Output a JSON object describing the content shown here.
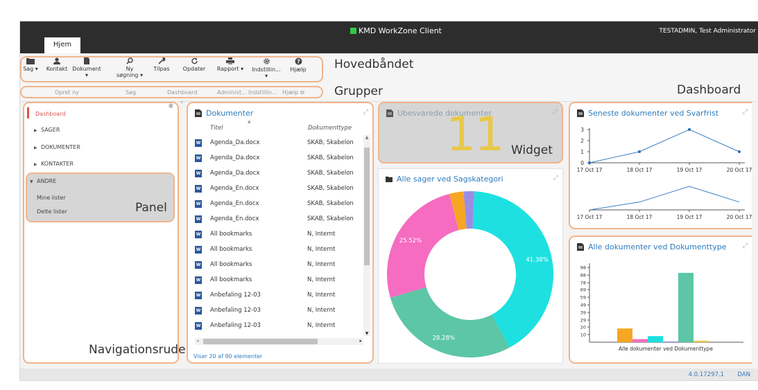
{
  "window": {
    "title": "KMD WorkZone Client",
    "user": "TESTADMIN, Test Administrator"
  },
  "tabs": [
    {
      "label": "Hjem"
    }
  ],
  "ribbon": {
    "buttons": [
      {
        "label": "Sag",
        "dropdown": true
      },
      {
        "label": "Kontakt"
      },
      {
        "label": "Dokument"
      },
      {
        "label": "Ny søgning"
      },
      {
        "label": "Tilpas"
      },
      {
        "label": "Opdater"
      },
      {
        "label": "Rapport",
        "dropdown": true
      },
      {
        "label": "Indstillin..."
      },
      {
        "label": "Hjælp"
      }
    ],
    "groups": [
      "Opret ny",
      "Søg",
      "Dashboard",
      "Administ...",
      "Indstillin...",
      "Hjælp"
    ]
  },
  "callouts": {
    "ribbon": "Hovedbåndet",
    "groups": "Grupper",
    "dashboard": "Dashboard",
    "widget": "Widget",
    "panel": "Panel",
    "nav": "Navigationsrude"
  },
  "nav": {
    "dashboard": "Dashboard",
    "items": [
      "SAGER",
      "DOKUMENTER",
      "KONTAKTER"
    ],
    "andre": "ANDRE",
    "sub": [
      "Mine lister",
      "Delte lister"
    ]
  },
  "documents": {
    "title": "Dokumenter",
    "columns": [
      "Titel",
      "Dokumenttype"
    ],
    "rows": [
      {
        "title": "Agenda_Da.docx",
        "type": "SKAB, Skabelon"
      },
      {
        "title": "Agenda_Da.docx",
        "type": "SKAB, Skabelon"
      },
      {
        "title": "Agenda_Da.docx",
        "type": "SKAB, Skabelon"
      },
      {
        "title": "Agenda_En.docx",
        "type": "SKAB, Skabelon"
      },
      {
        "title": "Agenda_En.docx",
        "type": "SKAB, Skabelon"
      },
      {
        "title": "Agenda_En.docx",
        "type": "SKAB, Skabelon"
      },
      {
        "title": "All bookmarks",
        "type": "N, Internt"
      },
      {
        "title": "All bookmarks",
        "type": "N, Internt"
      },
      {
        "title": "All bookmarks",
        "type": "N, Internt"
      },
      {
        "title": "All bookmarks",
        "type": "N, Internt"
      },
      {
        "title": "Anbefaling 12-03",
        "type": "N, Internt"
      },
      {
        "title": "Anbefaling 12-03",
        "type": "N, Internt"
      },
      {
        "title": "Anbefaling 12-03",
        "type": "N, Internt"
      }
    ],
    "footer": "Viser 20 af 90 elementer"
  },
  "widgets": {
    "unanswered": {
      "title": "Ubesvarede dokumenter",
      "value": "11"
    },
    "cases": {
      "title": "Alle sager ved Sagskategori"
    },
    "deadline": {
      "title": "Seneste dokumenter ved Svarfrist"
    },
    "doctype": {
      "title": "Alle dokumenter ved Dokumenttype"
    }
  },
  "status": {
    "version": "4.0.17297.1",
    "lang": "DAN"
  },
  "colors": {
    "accent": "#2e7bbd",
    "orange": "#f0b48a",
    "gold": "#e8c84a"
  },
  "chart_data": [
    {
      "type": "pie",
      "title": "Alle sager ved Sagskategori",
      "categories": [
        "",
        "",
        "",
        "",
        ""
      ],
      "values": [
        41.38,
        28.28,
        25.52,
        2.76,
        2.06
      ],
      "labels": [
        "41.38%",
        "28.28%",
        "25.52%",
        "",
        ""
      ],
      "colors": [
        "#1ee0e0",
        "#5cc6a6",
        "#f56cc0",
        "#f5a623",
        "#9b8ce6"
      ]
    },
    {
      "type": "line",
      "title": "Seneste dokumenter ved Svarfrist",
      "x": [
        "17 Oct 17",
        "18 Oct 17",
        "19 Oct 17",
        "20 Oct 17"
      ],
      "y_ticks": [
        "3",
        "2",
        "1",
        "0"
      ],
      "series": [
        {
          "values": [
            0,
            1,
            3,
            1
          ]
        }
      ],
      "ylim": [
        0,
        3
      ]
    },
    {
      "type": "line",
      "title": "Seneste dokumenter ved Svarfrist",
      "x": [
        "17 Oct 17",
        "18 Oct 17",
        "19 Oct 17",
        "20 Oct 17"
      ],
      "series": [
        {
          "values": [
            0,
            1,
            3,
            1
          ]
        }
      ],
      "ylim": [
        0,
        3
      ]
    },
    {
      "type": "bar",
      "title": "Alle dokumenter ved Dokumenttype",
      "xlabel": "Alle dokumenter ved Dokumenttype",
      "y_ticks": [
        "98",
        "88",
        "78",
        "69",
        "59",
        "49",
        "39",
        "29",
        "20",
        "10"
      ],
      "values": [
        18,
        4,
        8,
        0,
        91,
        2
      ],
      "colors": [
        "#f5a623",
        "#f56cc0",
        "#1ee0e0",
        "#9b8ce6",
        "#5cc6a6",
        "#e8c84a"
      ],
      "ylim": [
        0,
        100
      ]
    }
  ]
}
